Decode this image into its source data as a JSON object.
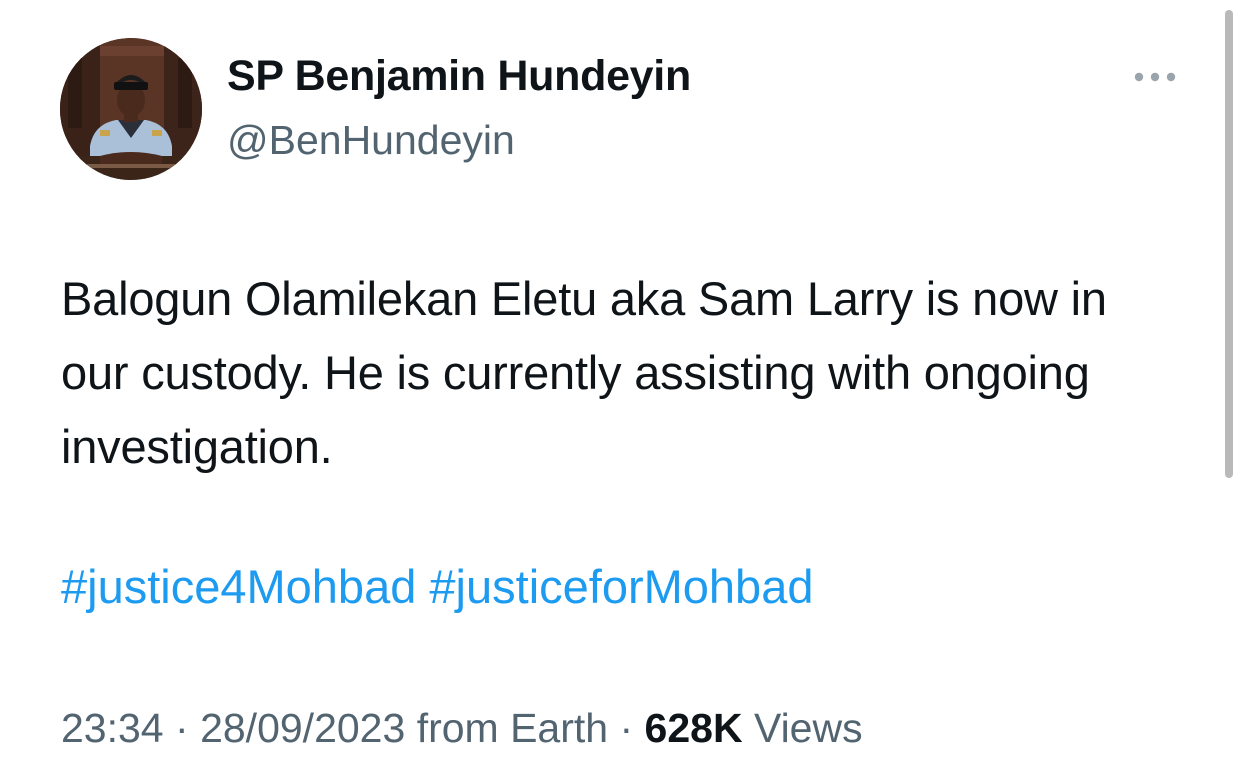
{
  "author": {
    "display_name": "SP Benjamin Hundeyin",
    "handle": "@BenHundeyin"
  },
  "tweet": {
    "text": "Balogun Olamilekan Eletu aka Sam Larry is now in our custody. He is currently assisting with ongoing investigation.",
    "hashtags": [
      "#justice4Mohbad",
      "#justiceforMohbad"
    ],
    "time": "23:34",
    "date": "28/09/2023",
    "source": "from Earth",
    "separator": "·",
    "views_count": "628K",
    "views_label": "Views"
  },
  "icons": {
    "more": "more-horizontal-icon"
  },
  "colors": {
    "text_primary": "#0f1419",
    "text_secondary": "#536471",
    "link": "#1d9bf0"
  }
}
